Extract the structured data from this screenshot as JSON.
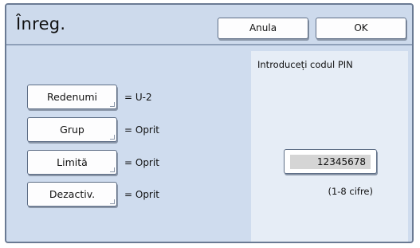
{
  "header": {
    "title": "Înreg.",
    "cancel_label": "Anula",
    "ok_label": "OK"
  },
  "settings": [
    {
      "label": "Redenumi",
      "value": "= U-2"
    },
    {
      "label": "Grup",
      "value": "= Oprit"
    },
    {
      "label": "Limită",
      "value": "= Oprit"
    },
    {
      "label": "Dezactiv.",
      "value": "= Oprit"
    }
  ],
  "pin": {
    "label": "Introduceți codul PIN",
    "value": "12345678",
    "hint": "(1-8 cifre)"
  }
}
